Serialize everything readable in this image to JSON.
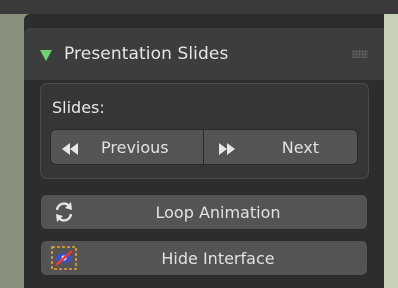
{
  "panel": {
    "title": "Presentation Slides"
  },
  "slides": {
    "label": "Slides:",
    "previous_label": "Previous",
    "next_label": "Next"
  },
  "actions": {
    "loop_label": "Loop Animation",
    "hide_label": "Hide Interface"
  },
  "icons": {
    "collapse": "expanded-triangle-icon",
    "grip": "drag-grip-icon",
    "previous": "rewind-icon",
    "next": "fast-forward-icon",
    "loop": "loop-arrows-icon",
    "hide": "hide-interface-icon"
  },
  "colors": {
    "triangle": "#6fd16f",
    "panel_bg": "#2d2d2d",
    "header_bg": "#3d3d3d",
    "button_bg": "#545454",
    "hide_icon_accent": "#e23b3b"
  }
}
